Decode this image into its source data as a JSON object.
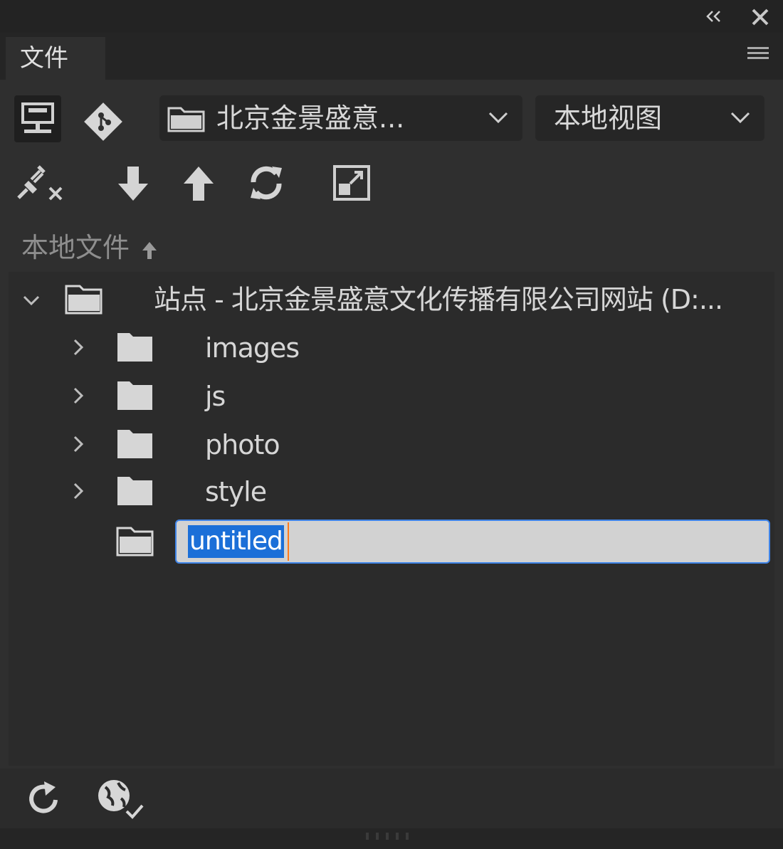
{
  "panel": {
    "tab_label": "文件"
  },
  "toolbar": {
    "site_select_value": "北京金景盛意...",
    "view_select_value": "本地视图"
  },
  "file_list": {
    "column_header": "本地文件",
    "root_label": "站点 - 北京金景盛意文化传播有限公司网站 (D:...",
    "items": [
      {
        "label": "images",
        "type": "folder"
      },
      {
        "label": "js",
        "type": "folder"
      },
      {
        "label": "photo",
        "type": "folder"
      },
      {
        "label": "style",
        "type": "folder"
      }
    ],
    "new_item_value": "untitled"
  },
  "icons": {
    "collapse": "double-chevron-left-icon",
    "close": "close-icon",
    "panel_menu": "menu-icon",
    "site": "site-server-icon",
    "git": "git-icon",
    "disconnect": "disconnect-plug-icon",
    "get": "download-arrow-icon",
    "put": "upload-arrow-icon",
    "refresh": "refresh-icon",
    "expand": "expand-panel-icon",
    "folder": "folder-icon",
    "sort": "sort-ascending-icon",
    "footer_refresh": "refresh-icon",
    "footer_globe": "globe-check-icon"
  },
  "colors": {
    "background": "#2f2f2f",
    "title_bar": "#232323",
    "selection": "#1b6fd8",
    "input_border": "#3f84e8",
    "text": "#d6d6d6"
  }
}
